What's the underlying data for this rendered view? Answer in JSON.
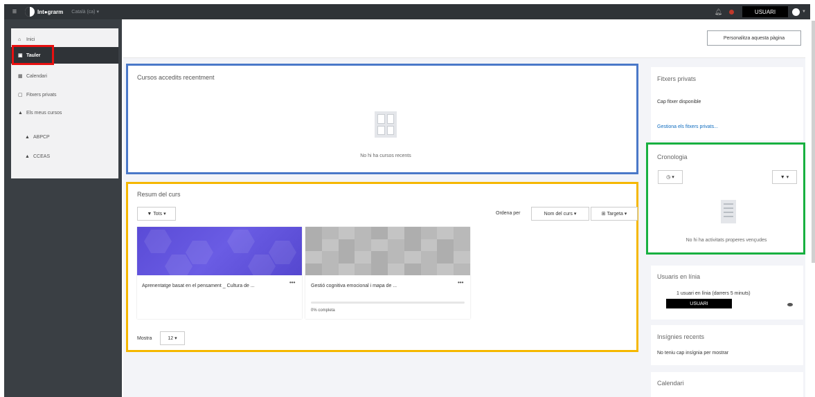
{
  "navbar": {
    "logo_text": "Int●grarm",
    "language": "Català (ca) ▾",
    "user_name": "USUARI"
  },
  "drawer": {
    "items": [
      {
        "label": "Inici",
        "icon": "home-icon"
      },
      {
        "label": "Tauler",
        "icon": "dashboard-icon",
        "active": true
      },
      {
        "label": "Calendari",
        "icon": "calendar-icon"
      },
      {
        "label": "Fitxers privats",
        "icon": "file-icon"
      },
      {
        "label": "Els meus cursos",
        "icon": "graduation-cap-icon"
      },
      {
        "label": "ABPCP",
        "icon": "graduation-cap-icon"
      },
      {
        "label": "CCEAS",
        "icon": "graduation-cap-icon"
      }
    ]
  },
  "header": {
    "customise_label": "Personalitza aquesta pàgina"
  },
  "recent_courses": {
    "title": "Cursos accedits recentment",
    "empty_text": "No hi ha cursos recents"
  },
  "course_overview": {
    "title": "Resum del curs",
    "filter_label": "Tots",
    "sort_prefix": "Ordena per",
    "sort_value": "Nom del curs",
    "view_value": "Targeta",
    "show_label": "Mostra",
    "show_value": "12",
    "courses": [
      {
        "name": "Aprenentatge basat en el pensament _ Cultura de ..."
      },
      {
        "name": "Gestió cognitiva emocional i mapa de ...",
        "progress_label": "0% completa",
        "progress": 0
      }
    ]
  },
  "private_files": {
    "title": "Fitxers privats",
    "empty": "Cap fitxer disponible",
    "manage": "Gestiona els fitxers privats..."
  },
  "timeline": {
    "title": "Cronologia",
    "empty": "No hi ha activitats properes vençudes"
  },
  "online_users": {
    "title": "Usuaris en línia",
    "summary": "1 usuari en línia (darrers 5 minuts)",
    "user": "USUARI"
  },
  "badges": {
    "title": "Insígnies recents",
    "empty": "No teniu cap insígnia per mostrar"
  },
  "calendar": {
    "title": "Calendari"
  },
  "colors": {
    "navbar": "#2f3337",
    "highlight_red": "#e81010",
    "highlight_blue": "#4a78c8",
    "highlight_yellow": "#f5b700",
    "highlight_green": "#18b040"
  }
}
